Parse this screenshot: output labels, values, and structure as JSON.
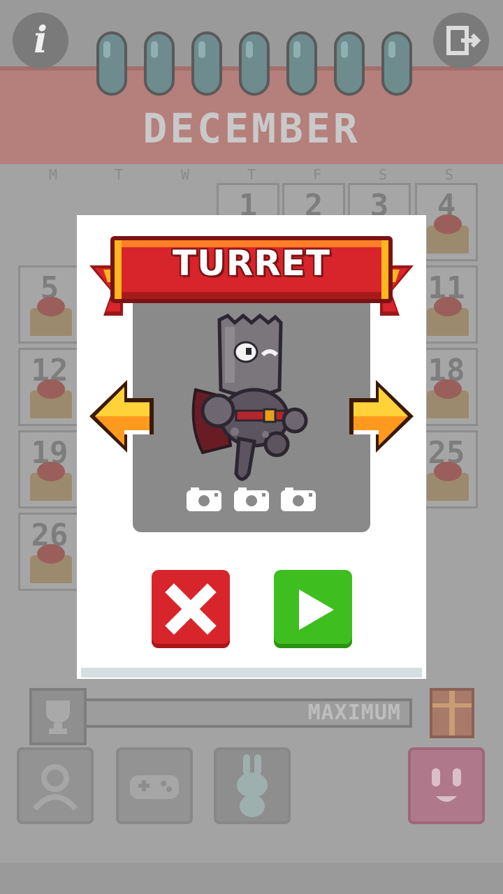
{
  "calendar": {
    "month": "DECEMBER",
    "weekdays": [
      "M",
      "T",
      "W",
      "T",
      "F",
      "S",
      "S"
    ],
    "visible_days": [
      "1",
      "2",
      "3",
      "4",
      "5",
      "11",
      "12",
      "18",
      "19",
      "25",
      "26"
    ],
    "progress_label": "MAXIMUM",
    "progress_fraction": 1.0
  },
  "top_bar": {
    "info_label": "i"
  },
  "modal": {
    "title": "TURRET",
    "snapshots_count": 3
  },
  "colors": {
    "banner_red": "#d8242b",
    "cancel_red": "#d8242b",
    "play_green": "#3fbe1f",
    "arrow_yellow": "#ffc21f",
    "card_gray": "#8a8a8a"
  },
  "icons": {
    "info": "info-icon",
    "exit": "exit-icon",
    "prev": "arrow-left-icon",
    "next": "arrow-right-icon",
    "camera": "camera-icon",
    "cancel": "close-icon",
    "play": "play-icon",
    "trophy": "trophy-icon",
    "gift": "gift-icon",
    "gamepad": "gamepad-icon",
    "profile": "profile-icon",
    "bunny": "bunny-icon",
    "face": "face-icon"
  }
}
